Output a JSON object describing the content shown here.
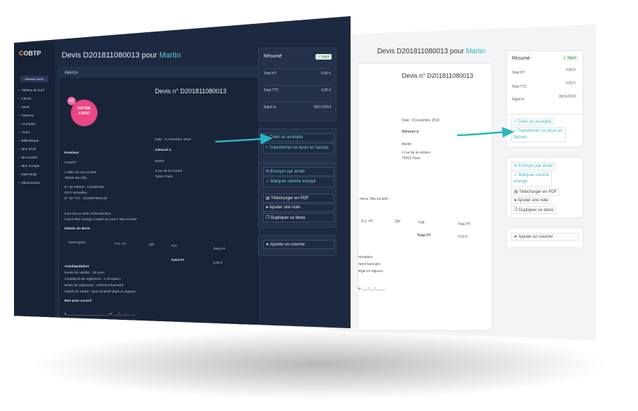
{
  "brand": {
    "logo_prefix": "C",
    "logo_rest": "OBTP"
  },
  "sidebar": {
    "new_quote": "Nouveau devis",
    "items": [
      "Tableau de bord",
      "Clients",
      "Devis",
      "Factures",
      "Acomptes",
      "Avoirs",
      "Bibliothèque",
      "Mon Profil",
      "Ma Société",
      "Mon Compte",
      "Dark Mode",
      "Déconnexion"
    ]
  },
  "header": {
    "title_prefix": "Devis D201811080013 pour",
    "client": "Martin"
  },
  "document": {
    "apercu": "Aperçu",
    "number": "Devis n° D201811080013",
    "logo_ici": "ici",
    "logo_text": "VOTRE LOGO",
    "date": "Date : 8 novembre 2018",
    "adresse_label": "Adressé à",
    "client_name": "Martin",
    "client_addr1": "4 rue de la victoire",
    "client_addr2": "75001 Paris",
    "emetteur_label": "Emetteur",
    "emetteur_name": "COBTP",
    "emetteur_addr1": "2 allée de ma société",
    "emetteur_addr2": "78000 Ma Ville",
    "siren": "N° de SIREN : 123456789",
    "rcs": "RCS Versailles",
    "tva": "N° de TVA : 1234567891234",
    "intro1": "Ceci est un texte d'introduction,",
    "intro2": "Il peut être changé à partir du menu \"Ma société\".",
    "details_label": "Détails du devis",
    "col_description": "Description",
    "col_pu": "P.U. HT",
    "col_qte": "Qté",
    "col_tva": "TVA",
    "col_total": "Total HT",
    "total_label": "Total HT",
    "total_value": "0,00 €",
    "autoliquidation": "Autoliquidation",
    "validite": "Durée de validité : 30 jours",
    "conditions": "Conditions de règlement : A réception",
    "mode": "Mode de règlement : Virement bancaire",
    "retard": "Intérêt de retard : Taux d'intérêt légal en vigueur",
    "bon_accord": "Bon pour accord",
    "lieu_date": "à ______________________ le ___/___/_____",
    "signature": "Signature"
  },
  "summary": {
    "title": "Résumé",
    "badge": "✓ Signé",
    "rows": [
      {
        "label": "Total HT",
        "value": "0,00 €"
      },
      {
        "label": "Total TTC",
        "value": "0,00 €"
      },
      {
        "label": "Signé le",
        "value": "08/11/2018"
      }
    ]
  },
  "actions": {
    "acompte": "+ Créer un acompte",
    "transformer": "+ Transformer ce devis en facture",
    "email": "✉ Envoyer par email",
    "marquer": "✓ Marquer comme envoyé",
    "pdf": "Télécharger en PDF",
    "note": "Ajouter une note",
    "dupliquer": "Dupliquer ce devis",
    "courrier": "Ajouter un courrier"
  },
  "light_screen": {
    "title_prefix": "Devis D201811080013 pour",
    "client": "Martin",
    "number": "Devis n° D201811080013",
    "date": "Date : 8 novembre 2018",
    "adresse_label": "Adressé à",
    "client_name": "Martin",
    "client_addr1": "4 rue de la victoire",
    "client_addr2": "75001 Paris",
    "menu_note": "menu \"Ma société\".",
    "col_pu": "P.U. HT",
    "col_qte": "Qté",
    "col_tva": "TVA",
    "col_total": "Total HT",
    "total_label": "Total HT",
    "total_value": "0,00 €",
    "reception": "réception",
    "virement": "ment bancaire",
    "legal": "légal en vigueur",
    "lieu_date": "le ___/___/_____",
    "summary_title": "Résumé",
    "badge": "✓ Signé",
    "rows": [
      {
        "label": "Total HT",
        "value": "0,00 €"
      },
      {
        "label": "Total TTC",
        "value": "0,00 €"
      },
      {
        "label": "Signé le",
        "value": "08/11/2019"
      }
    ],
    "acompte": "+ Créer un acompte",
    "transformer1": "+ Transformer ce devis en",
    "transformer2": "facture",
    "email": "✉ Envoyer par email",
    "marquer1": "✓ Marquer comme",
    "marquer2": "envoyé",
    "pdf": "Télécharger en PDF",
    "note": "Ajouter une note",
    "dupliquer": "Dupliquer ce devis",
    "courrier": "Ajouter un courrier"
  },
  "colors": {
    "accent": "#2bb6c4",
    "dark_bg": "#1d2940",
    "light_bg": "#f3f4f6"
  }
}
